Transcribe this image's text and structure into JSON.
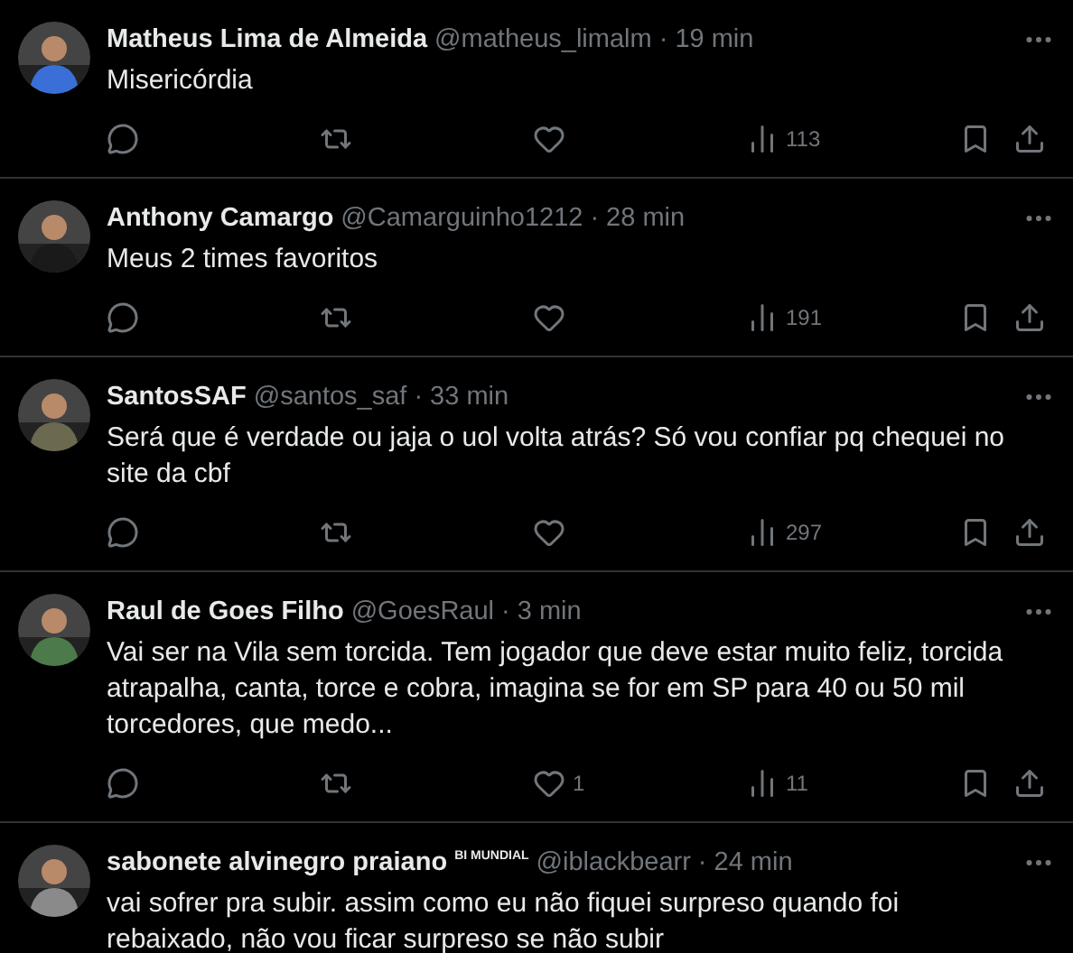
{
  "tweets": [
    {
      "name": "Matheus Lima de Almeida",
      "handle": "@matheus_limalm",
      "separator": "·",
      "time": "19 min",
      "text": "Misericórdia",
      "views": "113"
    },
    {
      "name": "Anthony Camargo",
      "handle": "@Camarguinho1212",
      "separator": "·",
      "time": "28 min",
      "text": "Meus 2 times favoritos",
      "views": "191"
    },
    {
      "name": "SantosSAF",
      "handle": "@santos_saf",
      "separator": "·",
      "time": "33 min",
      "text": "Será que é verdade ou jaja o uol volta atrás? Só vou confiar pq chequei no site da cbf",
      "views": "297"
    },
    {
      "name": "Raul de Goes Filho",
      "handle": "@GoesRaul",
      "separator": "·",
      "time": "3 min",
      "text": "Vai ser na Vila sem torcida. Tem jogador que deve estar muito feliz, torcida atrapalha, canta, torce e cobra, imagina se for em SP para 40 ou 50 mil torcedores, que medo...",
      "likes": "1",
      "views": "11"
    },
    {
      "name": "sabonete alvinegro praiano",
      "badge": "BI MUNDIAL",
      "handle": "@iblackbearr",
      "separator": "·",
      "time": "24 min",
      "text": "vai sofrer pra subir. assim como eu não fiquei surpreso quando foi rebaixado, não vou ficar surpreso se não subir"
    }
  ]
}
